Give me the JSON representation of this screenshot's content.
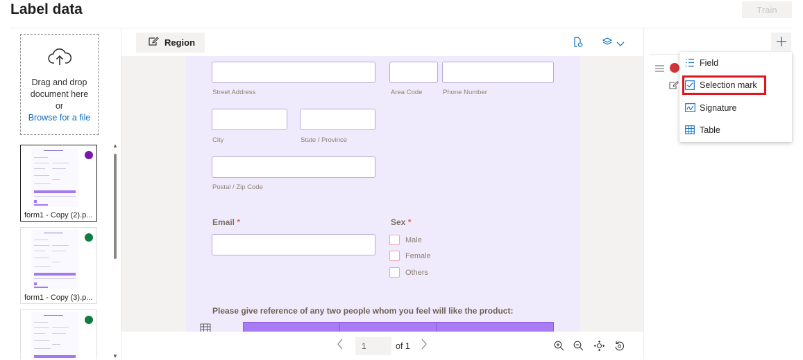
{
  "header": {
    "title": "Label data",
    "train_label": "Train"
  },
  "upload": {
    "line1": "Drag and drop",
    "line2": "document here",
    "line3": "or",
    "browse_label": "Browse for a file"
  },
  "documents": [
    {
      "label": "form1 - Copy (2).p...",
      "status_color": "#7719aa",
      "selected": true
    },
    {
      "label": "form1 - Copy (3).p...",
      "status_color": "#107c41",
      "selected": false
    },
    {
      "label": "",
      "status_color": "#107c41",
      "selected": false
    }
  ],
  "toolbar": {
    "region_label": "Region"
  },
  "form": {
    "street_address": "Street Address",
    "area_code": "Area Code",
    "phone_number": "Phone Number",
    "city": "City",
    "state": "State / Province",
    "postal": "Postal / Zip Code",
    "email": "Email",
    "sex": "Sex",
    "required_mark": "*",
    "sex_options": [
      "Male",
      "Female",
      "Others"
    ],
    "reference_prompt": "Please give reference of any two people whom you feel will like the product:"
  },
  "pager": {
    "current_page": "1",
    "of_text": "of 1"
  },
  "menu": {
    "items": [
      "Field",
      "Selection mark",
      "Signature",
      "Table"
    ]
  },
  "colors": {
    "accent": "#0f6cbd",
    "highlight": "#e0161f",
    "label_dot": "#d13438"
  }
}
